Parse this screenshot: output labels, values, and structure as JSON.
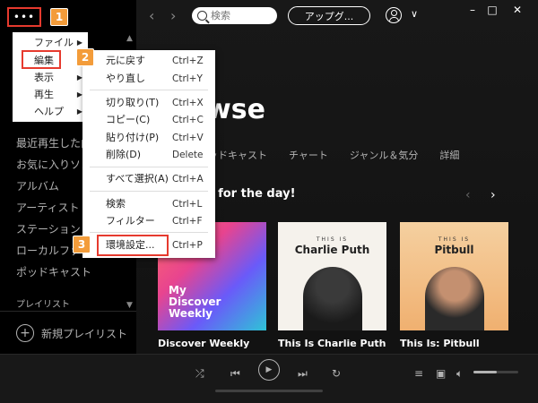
{
  "sidebar": {
    "menu_dots": "•••",
    "items": [
      {
        "label": "最近再生した曲"
      },
      {
        "label": "お気に入りソング"
      },
      {
        "label": "アルバム"
      },
      {
        "label": "アーティスト"
      },
      {
        "label": "ステーション"
      },
      {
        "label": "ローカルファイル"
      },
      {
        "label": "ポッドキャスト"
      }
    ],
    "playlist_heading": "プレイリスト",
    "new_playlist": "新規プレイリスト"
  },
  "main_menu": {
    "items": [
      {
        "label": "ファイル"
      },
      {
        "label": "編集"
      },
      {
        "label": "表示"
      },
      {
        "label": "再生"
      },
      {
        "label": "ヘルプ"
      }
    ]
  },
  "edit_menu": {
    "items": [
      {
        "label": "元に戻す",
        "shortcut": "Ctrl+Z"
      },
      {
        "label": "やり直し",
        "shortcut": "Ctrl+Y"
      },
      {
        "label": "切り取り(T)",
        "shortcut": "Ctrl+X"
      },
      {
        "label": "コピー(C)",
        "shortcut": "Ctrl+C"
      },
      {
        "label": "貼り付け(P)",
        "shortcut": "Ctrl+V"
      },
      {
        "label": "削除(D)",
        "shortcut": "Delete"
      },
      {
        "label": "すべて選択(A)",
        "shortcut": "Ctrl+A"
      },
      {
        "label": "検索",
        "shortcut": "Ctrl+L"
      },
      {
        "label": "フィルター",
        "shortcut": "Ctrl+F"
      },
      {
        "label": "環境設定...",
        "shortcut": "Ctrl+P"
      }
    ]
  },
  "badges": [
    "1",
    "2",
    "3"
  ],
  "topbar": {
    "search_placeholder": "検索",
    "upgrade_label": "アップグ..."
  },
  "browse": {
    "title": "wse",
    "tabs": [
      "ッドキャスト",
      "チャート",
      "ジャンル＆気分",
      "詳細"
    ],
    "section_heading": "es for the day!"
  },
  "cards": [
    {
      "cover_text": "My Discover Weekly",
      "title": "Discover Weekly"
    },
    {
      "this_is": "THIS IS",
      "artist": "Charlie Puth",
      "title": "This Is Charlie Puth"
    },
    {
      "this_is": "THIS IS",
      "artist": "Pitbull",
      "title": "This Is: Pitbull"
    }
  ],
  "player": {
    "volume_level": 0.52
  },
  "colors": {
    "highlight_border": "#e63a2e",
    "badge": "#f39c3a",
    "sidebar_bg": "#000000",
    "main_bg": "#121212"
  }
}
